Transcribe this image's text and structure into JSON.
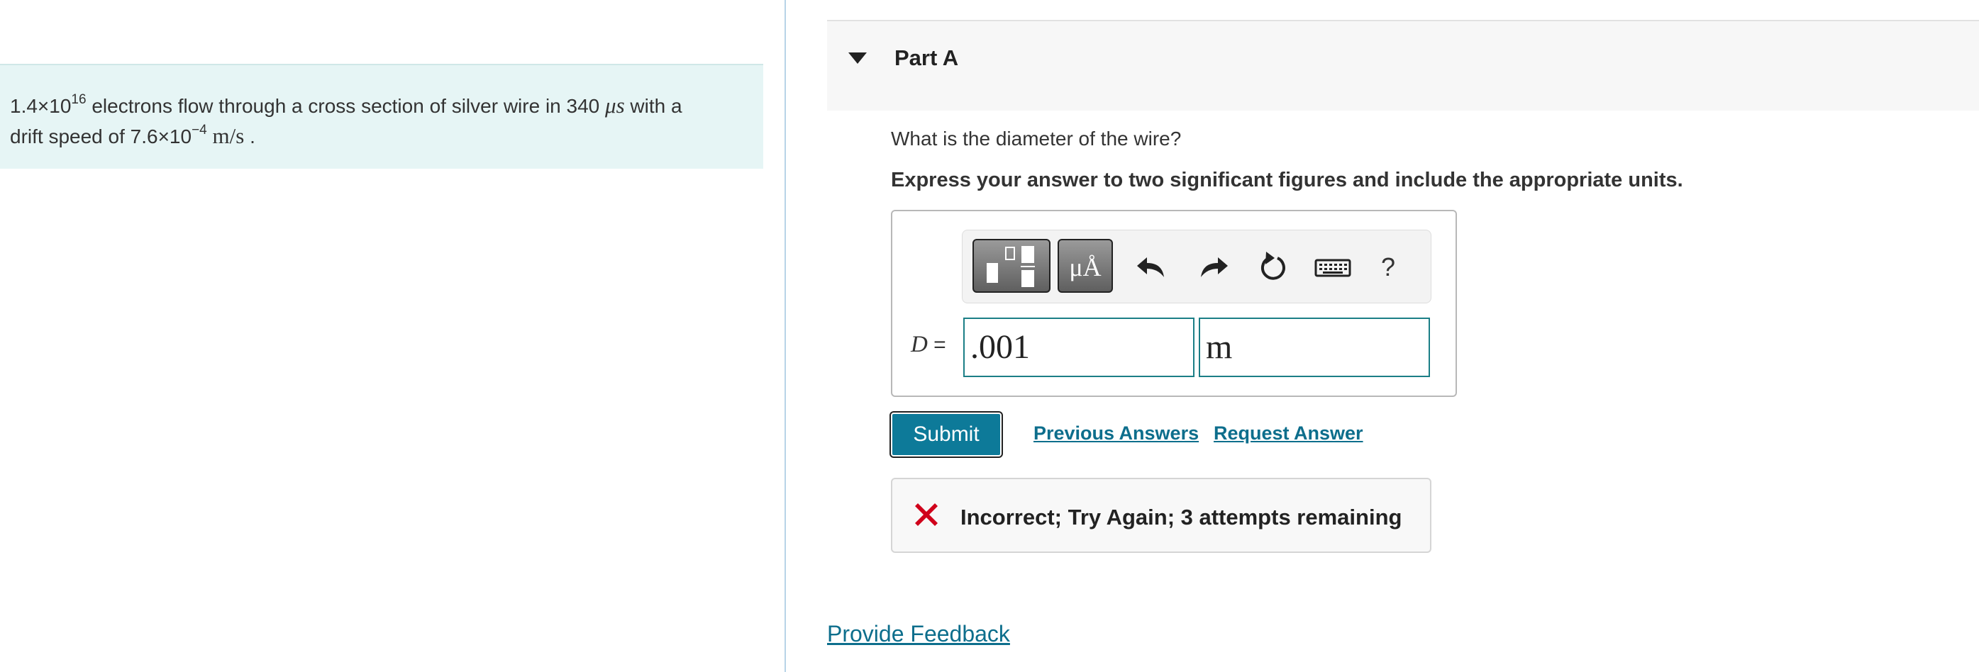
{
  "problem": {
    "count_base": "1.4×10",
    "count_exp": "16",
    "text_1": " electrons flow through a cross section of silver wire in 340 ",
    "time_unit": "μs",
    "text_2": " with a",
    "text_3": "drift speed of 7.6×10",
    "speed_exp": "−4",
    "speed_unit": "m/s",
    "text_4": " ."
  },
  "part": {
    "title": "Part A",
    "question": "What is the diameter of the wire?",
    "instruction": "Express your answer to two significant figures and include the appropriate units."
  },
  "toolbar": {
    "templates_icon": "templates-icon",
    "units_label": "μÅ",
    "undo_icon": "undo-icon",
    "redo_icon": "redo-icon",
    "reset_icon": "reset-icon",
    "keyboard_icon": "keyboard-icon",
    "help_label": "?"
  },
  "answer": {
    "variable": "D",
    "equals": " =",
    "value": ".001",
    "units": "m"
  },
  "actions": {
    "submit": "Submit",
    "previous_answers": "Previous Answers",
    "request_answer": "Request Answer"
  },
  "feedback": {
    "status_icon": "x-icon",
    "message": "Incorrect; Try Again; 3 attempts remaining"
  },
  "footer": {
    "provide_feedback": "Provide Feedback"
  },
  "colors": {
    "accent": "#0d7a99",
    "link": "#0d6e8c",
    "error": "#d0021b",
    "problem_background": "#e6f5f5"
  }
}
